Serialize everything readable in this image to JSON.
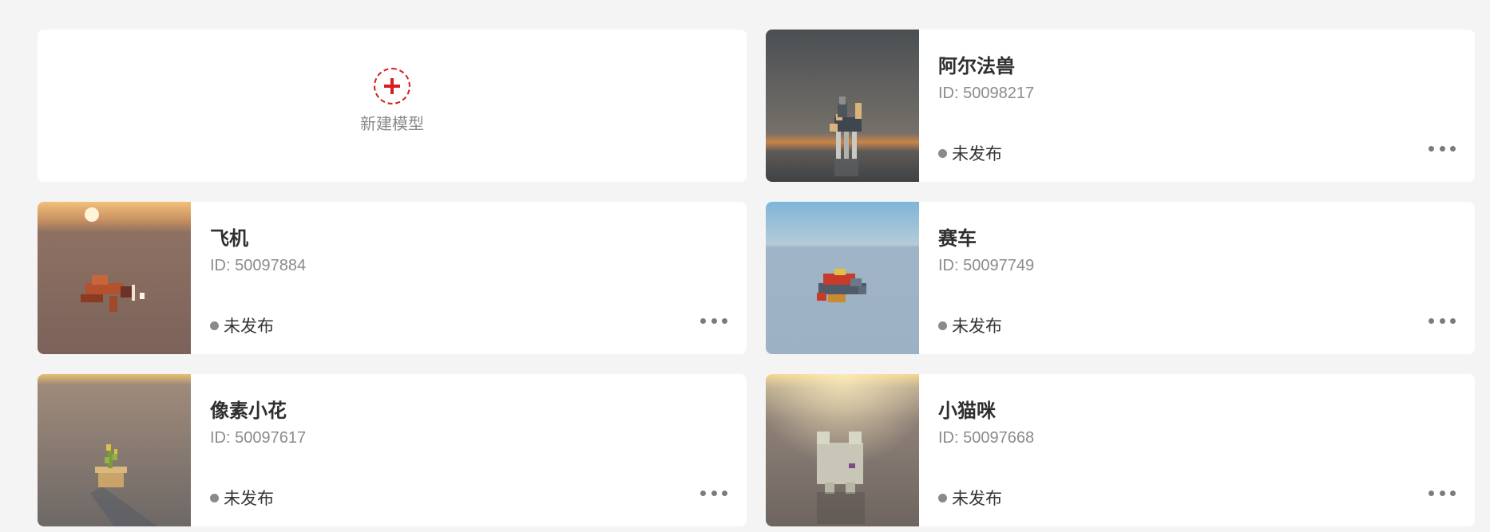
{
  "new_card": {
    "label": "新建模型",
    "accent": "#d81e1e"
  },
  "models": [
    {
      "title": "阿尔法兽",
      "id_text": "ID: 50098217",
      "status": "未发布",
      "thumb": "dog-voxel-model-icon"
    },
    {
      "title": "飞机",
      "id_text": "ID: 50097884",
      "status": "未发布",
      "thumb": "airplane-voxel-model-icon"
    },
    {
      "title": "赛车",
      "id_text": "ID: 50097749",
      "status": "未发布",
      "thumb": "race-car-voxel-model-icon"
    },
    {
      "title": "像素小花",
      "id_text": "ID: 50097617",
      "status": "未发布",
      "thumb": "flower-pot-voxel-model-icon"
    },
    {
      "title": "小猫咪",
      "id_text": "ID: 50097668",
      "status": "未发布",
      "thumb": "cat-voxel-model-icon"
    }
  ]
}
